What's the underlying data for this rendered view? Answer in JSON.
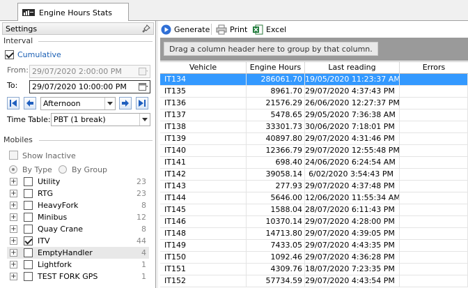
{
  "tab": {
    "title": "Engine Hours Stats",
    "icon": "report-icon"
  },
  "settings": {
    "title": "Settings",
    "interval": {
      "title": "Interval",
      "cumulative_label": "Cumulative",
      "cumulative_checked": true,
      "from_label": "From:",
      "from_value": "29/07/2020   2:00:00 PM",
      "to_label": "To:",
      "to_value": "29/07/2020 10:00:00 PM",
      "shift_value": "Afternoon",
      "timetable_label": "Time Table:",
      "timetable_value": "PBT (1 break)"
    },
    "mobiles": {
      "title": "Mobiles",
      "show_inactive_label": "Show Inactive",
      "by_type_label": "By Type",
      "by_group_label": "By Group",
      "items": [
        {
          "label": "Utility",
          "count": "23",
          "checked": false
        },
        {
          "label": "RTG",
          "count": "23",
          "checked": false
        },
        {
          "label": "HeavyFork",
          "count": "8",
          "checked": false
        },
        {
          "label": "Minibus",
          "count": "12",
          "checked": false
        },
        {
          "label": "Quay Crane",
          "count": "8",
          "checked": false
        },
        {
          "label": "ITV",
          "count": "44",
          "checked": true
        },
        {
          "label": "EmptyHandler",
          "count": "4",
          "checked": false
        },
        {
          "label": "Lightfork",
          "count": "1",
          "checked": false
        },
        {
          "label": "TEST FORK GPS",
          "count": "1",
          "checked": false
        }
      ]
    }
  },
  "toolbar": {
    "generate_label": "Generate",
    "print_label": "Print",
    "excel_label": "Excel"
  },
  "grid": {
    "group_hint": "Drag a column header here to group by that column.",
    "columns": [
      "Vehicle",
      "Engine Hours",
      "Last reading",
      "Errors"
    ],
    "rows": [
      {
        "vehicle": "IT134",
        "hours": "286061.70",
        "reading": "19/05/2020 11:23:37 AM",
        "errors": ""
      },
      {
        "vehicle": "IT135",
        "hours": "8961.70",
        "reading": "29/07/2020 4:37:43 PM",
        "errors": ""
      },
      {
        "vehicle": "IT136",
        "hours": "21576.29",
        "reading": "26/06/2020 12:27:37 PM",
        "errors": ""
      },
      {
        "vehicle": "IT137",
        "hours": "5478.65",
        "reading": "29/05/2020 7:36:38 AM",
        "errors": ""
      },
      {
        "vehicle": "IT138",
        "hours": "33301.73",
        "reading": "30/06/2020 7:18:01 PM",
        "errors": ""
      },
      {
        "vehicle": "IT139",
        "hours": "40897.80",
        "reading": "29/07/2020 4:31:46 PM",
        "errors": ""
      },
      {
        "vehicle": "IT140",
        "hours": "12366.79",
        "reading": "29/07/2020 12:55:48 PM",
        "errors": ""
      },
      {
        "vehicle": "IT141",
        "hours": "698.40",
        "reading": "24/06/2020 6:24:54 AM",
        "errors": ""
      },
      {
        "vehicle": "IT142",
        "hours": "39058.14",
        "reading": "6/02/2020 3:54:43 PM",
        "errors": ""
      },
      {
        "vehicle": "IT143",
        "hours": "277.93",
        "reading": "29/07/2020 4:37:48 PM",
        "errors": ""
      },
      {
        "vehicle": "IT144",
        "hours": "5646.00",
        "reading": "12/06/2020 11:55:34 AM",
        "errors": ""
      },
      {
        "vehicle": "IT145",
        "hours": "1588.04",
        "reading": "28/07/2020 6:11:43 PM",
        "errors": ""
      },
      {
        "vehicle": "IT146",
        "hours": "10370.14",
        "reading": "29/07/2020 4:28:00 PM",
        "errors": ""
      },
      {
        "vehicle": "IT148",
        "hours": "14713.80",
        "reading": "29/07/2020 4:39:05 PM",
        "errors": ""
      },
      {
        "vehicle": "IT149",
        "hours": "7433.05",
        "reading": "29/07/2020 4:43:35 PM",
        "errors": ""
      },
      {
        "vehicle": "IT150",
        "hours": "1092.46",
        "reading": "29/07/2020 4:36:28 PM",
        "errors": ""
      },
      {
        "vehicle": "IT151",
        "hours": "4309.76",
        "reading": "18/07/2020 7:23:35 PM",
        "errors": ""
      },
      {
        "vehicle": "IT152",
        "hours": "57734.59",
        "reading": "29/07/2020 4:43:54 PM",
        "errors": ""
      }
    ]
  },
  "colors": {
    "selection": "#3399ff",
    "group_panel": "#9a9a9a",
    "label_blue": "#1a5fb4"
  }
}
